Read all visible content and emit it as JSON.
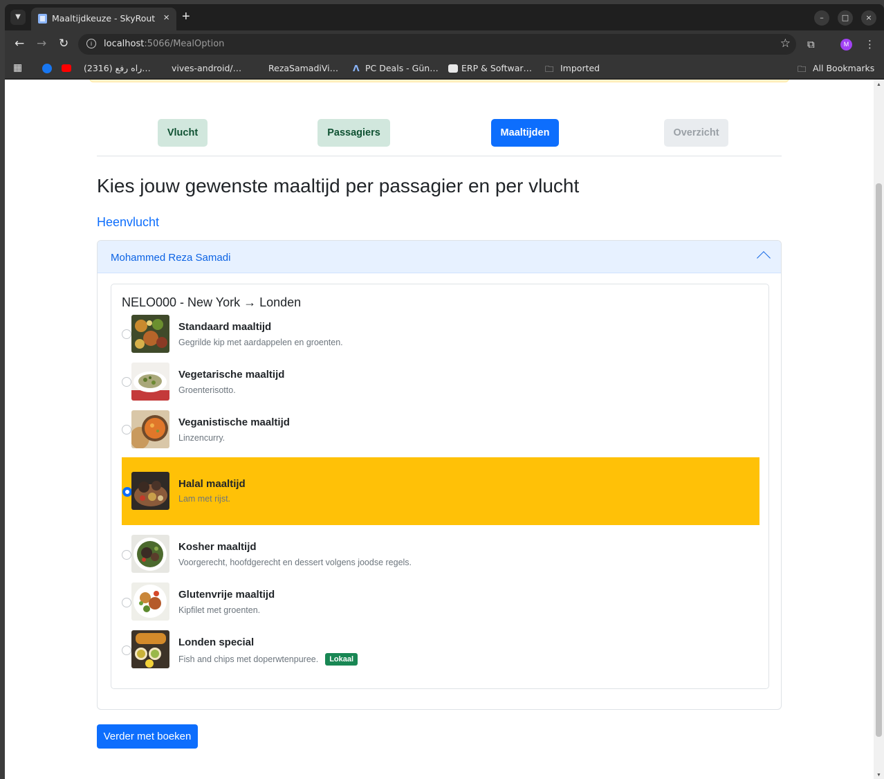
{
  "browser": {
    "tab_title": "Maaltijdkeuze - SkyRoute",
    "tab_close": "×",
    "new_tab": "+",
    "url_host": "localhost",
    "url_path": ":5066/MealOption",
    "window_min": "–",
    "window_max": "□",
    "window_close": "×",
    "profile_initial": "M",
    "bookmarks": [
      {
        "label": "(2316) راه رفع…"
      },
      {
        "label": "vives-android/…"
      },
      {
        "label": "RezaSamadiVi…"
      },
      {
        "label": "PC Deals - Gün…"
      },
      {
        "label": "ERP & Softwar…"
      },
      {
        "label": "Imported"
      }
    ],
    "all_bookmarks": "All Bookmarks"
  },
  "steps": [
    {
      "label": "Vlucht",
      "state": "done"
    },
    {
      "label": "Passagiers",
      "state": "done"
    },
    {
      "label": "Maaltijden",
      "state": "active"
    },
    {
      "label": "Overzicht",
      "state": "disabled"
    }
  ],
  "page": {
    "title": "Kies jouw gewenste maaltijd per passagier en per vlucht",
    "section": "Heenvlucht",
    "passenger": "Mohammed Reza Samadi",
    "flight": "NELO000 - New York → Londen",
    "continue_label": "Verder met boeken"
  },
  "meals": [
    {
      "name": "Standaard maaltijd",
      "desc": "Gegrilde kip met aardappelen en groenten.",
      "selected": false,
      "image": "grilled-chicken-image"
    },
    {
      "name": "Vegetarische maaltijd",
      "desc": "Groenterisotto.",
      "selected": false,
      "image": "risotto-image"
    },
    {
      "name": "Veganistische maaltijd",
      "desc": "Linzencurry.",
      "selected": false,
      "image": "lentil-curry-image"
    },
    {
      "name": "Halal maaltijd",
      "desc": "Lam met rijst.",
      "selected": true,
      "image": "lamb-rice-image"
    },
    {
      "name": "Kosher maaltijd",
      "desc": "Voorgerecht, hoofdgerecht en dessert volgens joodse regels.",
      "selected": false,
      "image": "kosher-salad-image"
    },
    {
      "name": "Glutenvrije maaltijd",
      "desc": "Kipfilet met groenten.",
      "selected": false,
      "image": "chicken-veg-image"
    },
    {
      "name": "Londen special",
      "desc": "Fish and chips met doperwtenpuree.",
      "badge": "Lokaal",
      "selected": false,
      "image": "fish-chips-image"
    }
  ],
  "colors": {
    "primary": "#0d6efd",
    "selected_row": "#ffc107",
    "done_step_bg": "#d1e7dd",
    "badge": "#198754"
  }
}
